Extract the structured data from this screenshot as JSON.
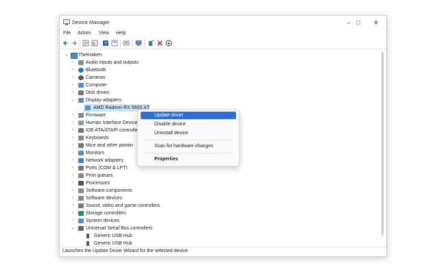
{
  "window": {
    "title": "Device Manager",
    "min_icon": "minimize-icon",
    "max_icon": "maximize-icon",
    "close_icon": "close-icon"
  },
  "menu": [
    "File",
    "Action",
    "View",
    "Help"
  ],
  "toolbar": [
    "back-arrow-icon",
    "forward-arrow-icon",
    "properties-icon",
    "tree-view-icon",
    "help-icon",
    "resources-icon",
    "update-driver-icon",
    "monitor-scan-icon",
    "enable-device-icon",
    "remove-device-icon",
    "download-driver-icon"
  ],
  "tree": {
    "root": "TheKraken",
    "categories": [
      "Audio inputs and outputs",
      "Bluetooth",
      "Cameras",
      "Computer",
      "Disk drives",
      "Display adapters",
      "AMD Radeon RX 5600 XT",
      "Firmware",
      "Human Interface Device",
      "IDE ATA/ATAPI controlle",
      "Keyboards",
      "Mice and other pointin",
      "Monitors",
      "Network adapters",
      "Ports (COM & LPT)",
      "Print queues",
      "Processors",
      "Software components",
      "Software devices",
      "Sound, video and game controllers",
      "Storage controllers",
      "System devices",
      "Universal Serial Bus controllers",
      "Generic USB Hub",
      "Generic USB Hub"
    ]
  },
  "context_menu": {
    "update_driver": "Update driver",
    "disable_device": "Disable device",
    "uninstall_device": "Uninstall device",
    "scan": "Scan for hardware changes",
    "properties": "Properties"
  },
  "status": "Launches the Update Driver Wizard for the selected device.",
  "colors": {
    "accent": "#2b6fd8",
    "selection": "#cde4f7"
  }
}
